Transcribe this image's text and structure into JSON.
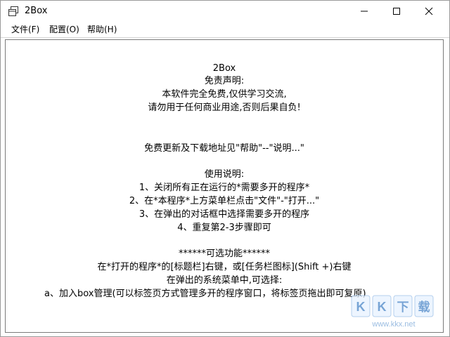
{
  "window": {
    "title": "2Box",
    "icons": {
      "app": "app-window-icon",
      "minimize": "minimize-icon",
      "maximize": "maximize-icon",
      "close": "close-icon"
    }
  },
  "menubar": {
    "items": [
      {
        "label": "文件(F)"
      },
      {
        "label": "配置(O)"
      },
      {
        "label": "帮助(H)"
      }
    ]
  },
  "content": {
    "lines": [
      "2Box",
      "免责声明:",
      "本软件完全免费,仅供学习交流,",
      "请勿用于任何商业用途,否则后果自负!",
      "",
      "免费更新及下载地址见\"帮助\"--\"说明...\"",
      "",
      "使用说明:",
      "1、关闭所有正在运行的*需要多开的程序*",
      "2、在*本程序*上方菜单栏点击\"文件\"-\"打开...\"",
      "3、在弹出的对话框中选择需要多开的程序",
      "4、重复第2-3步骤即可",
      "",
      "******可选功能******",
      "在*打开的程序*的[标题栏]右键，或[任务栏图标](Shift +)右键",
      "在弹出的系统菜单中,可选择:",
      "a、加入box管理(可以标签页方式管理多开的程序窗口，将标签页拖出即可复原)"
    ]
  },
  "watermark": {
    "text": "KK下载",
    "url": "www.kkx.net",
    "icon": "kk-download-logo"
  }
}
